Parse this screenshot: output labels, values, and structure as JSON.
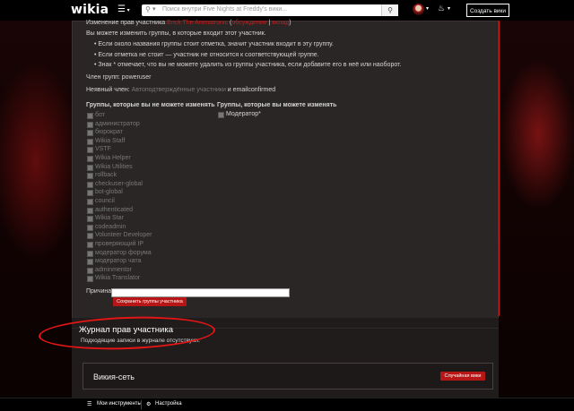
{
  "header": {
    "logo": "wikia",
    "menu_icon": "hamburger-icon",
    "search_placeholder": "Поиск внутри Five Nights at Freddy's вики...",
    "create_label": "Создать вики"
  },
  "rights": {
    "heading_prefix": "Изменение прав участника",
    "user": "Erick The Animatronic",
    "paren_open": " (",
    "discussion": "обсуждение",
    "pipe": " | ",
    "contrib": "вклад",
    "paren_close": ")",
    "intro": "Вы можете изменить группы, в которые входит этот участник.",
    "bullets": [
      "Если около названия группы стоит отметка, значит участник входит в эту группу.",
      "Если отметка не стоит — участник не относится к соответствующей группе.",
      "Знак * отмечает, что вы не можете удалить из группы участника, если добавите его в неё или наоборот."
    ],
    "member_of": "Член групп: poweruser",
    "implicit_prefix": "Неявный член: ",
    "implicit_groups": "Автоподтверждённые участники",
    "implicit_suffix": " и emailconfirmed",
    "col_left_title": "Группы, которые вы не можете изменять",
    "col_right_title": "Группы, которые вы можете изменять",
    "locked_groups": [
      "бот",
      "администратор",
      "бюрократ",
      "Wikia Staff",
      "VSTF",
      "Wikia Helper",
      "Wikia Utilities",
      "rollback",
      "checkuser-global",
      "bot-global",
      "council",
      "authenticated",
      "Wikia Star",
      "codeadmin",
      "Volunteer Developer",
      "проверяющий IP",
      "модератор форума",
      "модератор чата",
      "adminmentor",
      "Wikia Translator"
    ],
    "editable_groups": [
      "Модератор*"
    ],
    "reason_label": "Причина:",
    "save_label": "Сохранить группы участника"
  },
  "log": {
    "title": "Журнал прав участника",
    "empty": "Подходящие записи в журнале отсутствуют."
  },
  "wikinet": {
    "title": "Викия-сеть",
    "random_label": "Случайная вики"
  },
  "footer": {
    "tools": "Мои инструменты",
    "settings": "Настройка"
  },
  "colors": {
    "accent": "#c61b1b",
    "annotation": "#e31515"
  }
}
